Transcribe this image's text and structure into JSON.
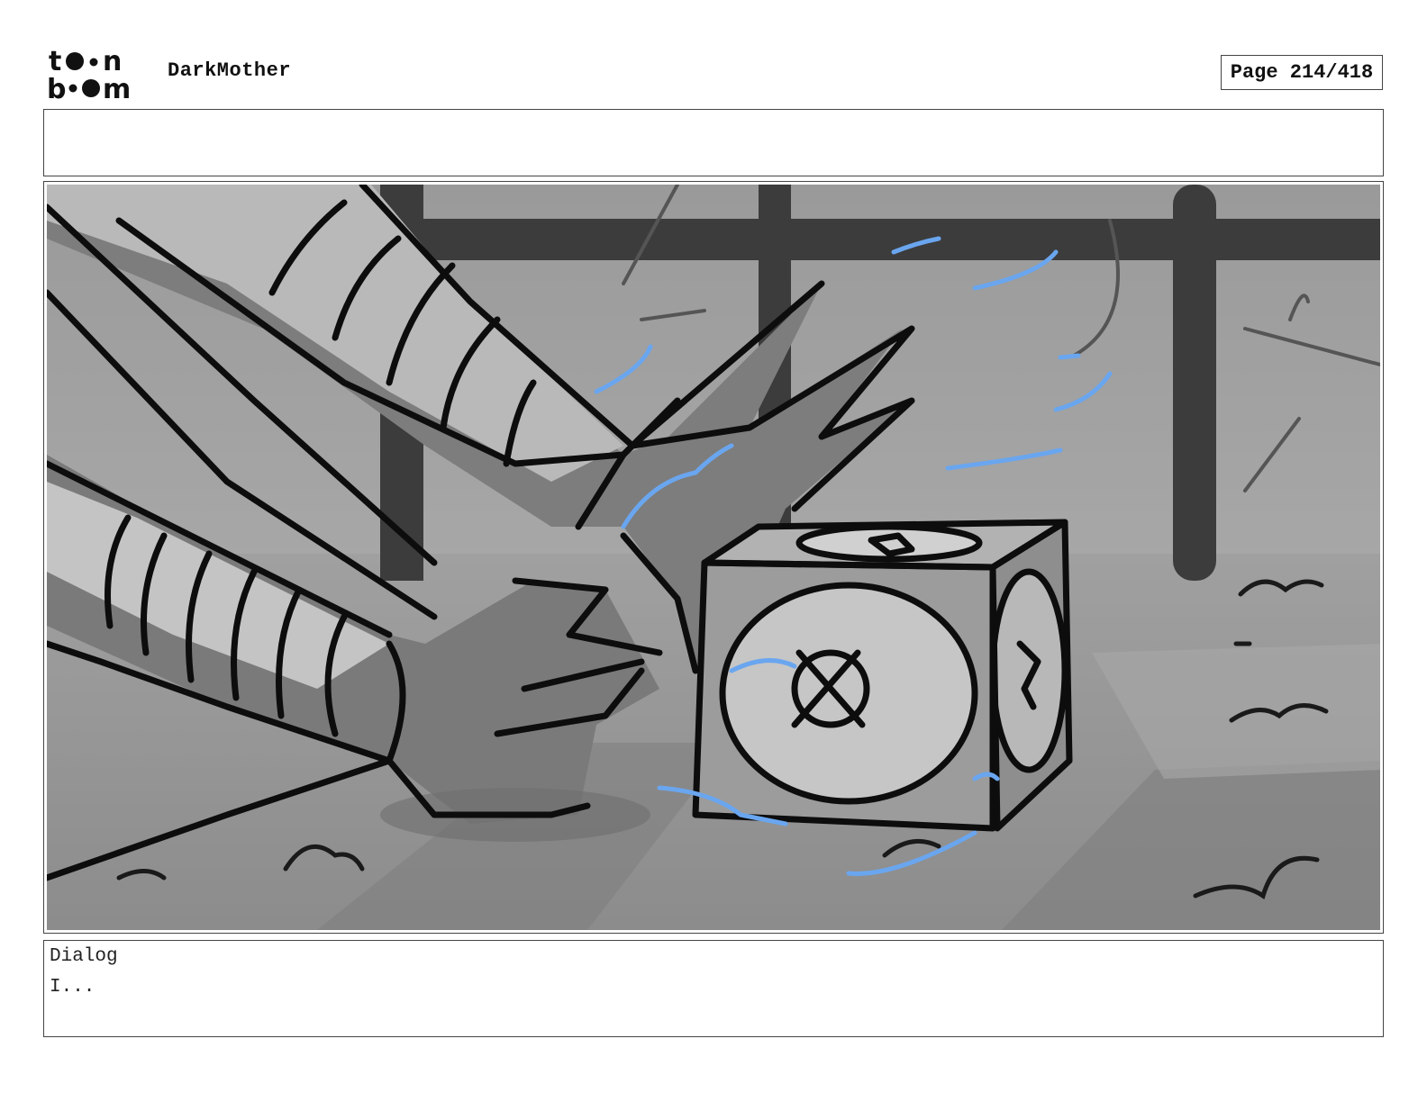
{
  "header": {
    "logo_alt": "toon boom",
    "project_title": "DarkMother",
    "page_label": "Page 214/418"
  },
  "notes": {
    "text": ""
  },
  "panel": {
    "icons": {
      "claw": "monster-claw-illustration",
      "cube": "puzzle-cube-illustration"
    },
    "colors": {
      "sketch_line": "#0d0d0d",
      "energy": "#6aa6ef",
      "background_gray": "#8a8a8a",
      "bars": "#3c3c3c"
    }
  },
  "dialog": {
    "label": "Dialog",
    "text": "I..."
  }
}
